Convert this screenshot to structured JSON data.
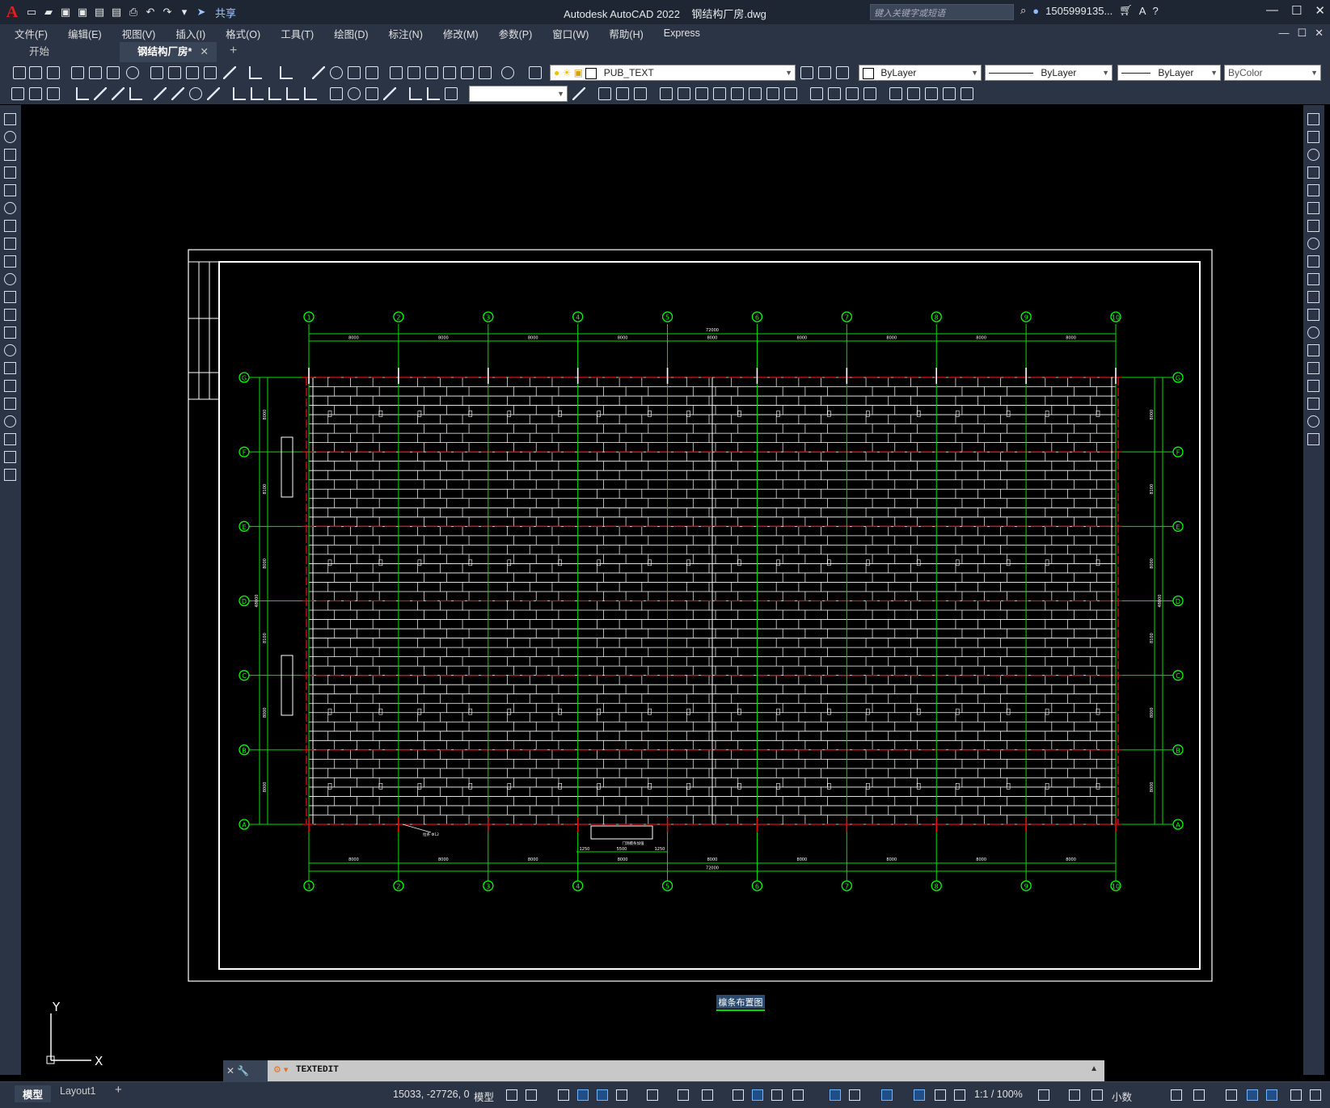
{
  "app": {
    "logo": "A",
    "title": "Autodesk AutoCAD 2022",
    "filename": "钢结构厂房.dwg",
    "share_label": "共享",
    "search_placeholder": "键入关键字或短语",
    "user": "1505999135...",
    "window_controls": [
      "—",
      "☐",
      "✕"
    ]
  },
  "menubar": {
    "items": [
      "文件(F)",
      "编辑(E)",
      "视图(V)",
      "插入(I)",
      "格式(O)",
      "工具(T)",
      "绘图(D)",
      "标注(N)",
      "修改(M)",
      "参数(P)",
      "窗口(W)",
      "帮助(H)",
      "Express"
    ]
  },
  "tabs": {
    "start": "开始",
    "doc": "钢结构厂房*",
    "close": "✕",
    "add": "+"
  },
  "toolbar": {
    "layer": "PUB_TEXT",
    "color": "ByLayer",
    "linetype": "ByLayer",
    "lineweight": "ByLayer",
    "plotstyle": "ByColor",
    "textstyle": ""
  },
  "drawing": {
    "title": "檩条布置图",
    "grid_numbers": [
      "1",
      "2",
      "3",
      "4",
      "5",
      "6",
      "7",
      "8",
      "9",
      "10"
    ],
    "grid_letters": [
      "G",
      "F",
      "E",
      "D",
      "C",
      "B",
      "A"
    ],
    "overall_width": "72000",
    "bay_spacing": [
      "8000",
      "8000",
      "8000",
      "8000",
      "8000",
      "8000",
      "8000",
      "8000",
      "8000"
    ],
    "overall_depth": "48000",
    "row_spacing": [
      "8000",
      "8100",
      "8000",
      "8100",
      "8000",
      "8000"
    ],
    "bottom_dims": [
      "8000",
      "8000",
      "8000",
      "8000",
      "8000",
      "8000",
      "8000",
      "8000",
      "8000"
    ],
    "door_dims": [
      "1250",
      "5500",
      "1250"
    ],
    "note_left": "拉条 Ф12",
    "note_door": "门洞檩条加强",
    "colors": {
      "grid": "#00e000",
      "axis_circle": "#00ff00",
      "frame": "#ffffff",
      "purlin": "#ffffff",
      "rafter": "#e01010",
      "title_bg": "#2b4a6e"
    }
  },
  "command": {
    "handle": "✕ 🔧",
    "text": "TEXTEDIT"
  },
  "status": {
    "model_tab": "模型",
    "layout_tab": "Layout1",
    "add_tab": "+",
    "coords": "15033, -27726, 0",
    "model_btn": "模型",
    "scale": "1:1 / 100%",
    "units": "小数"
  },
  "ucs": {
    "x": "X",
    "y": "Y"
  }
}
